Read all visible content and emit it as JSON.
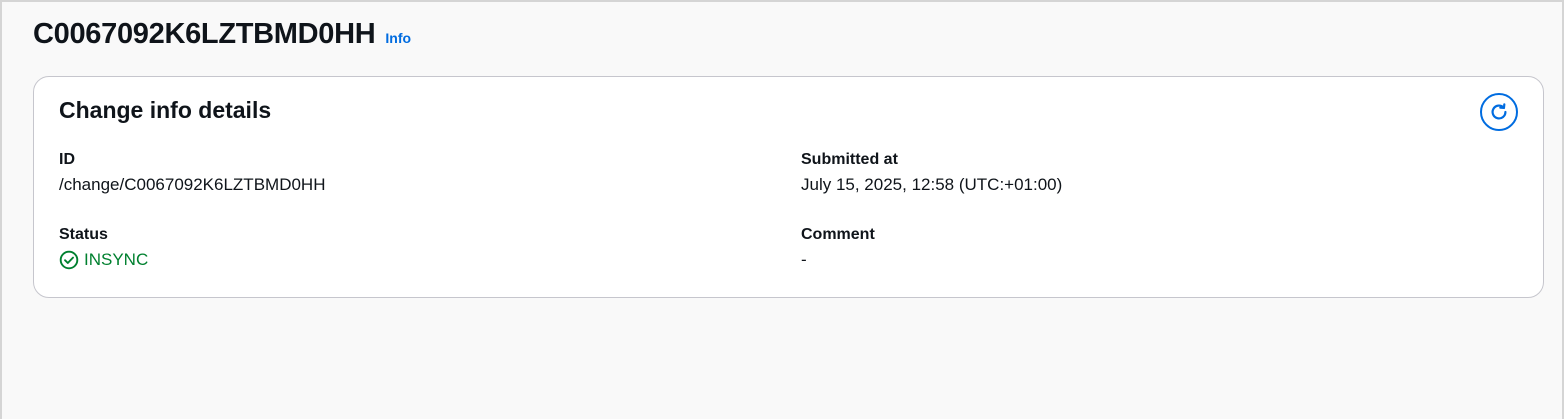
{
  "header": {
    "title": "C0067092K6LZTBMD0HH",
    "info_link": "Info"
  },
  "card": {
    "title": "Change info details",
    "refresh_icon": "refresh-icon",
    "fields": {
      "id": {
        "label": "ID",
        "value": "/change/C0067092K6LZTBMD0HH"
      },
      "submitted_at": {
        "label": "Submitted at",
        "value": "July 15, 2025, 12:58 (UTC:+01:00)"
      },
      "status": {
        "label": "Status",
        "value": "INSYNC",
        "icon": "check-circle-icon",
        "color": "#00802f"
      },
      "comment": {
        "label": "Comment",
        "value": "-"
      }
    }
  },
  "colors": {
    "link": "#006ce0",
    "success": "#00802f",
    "background": "#f9f9f9",
    "card": "#ffffff"
  }
}
